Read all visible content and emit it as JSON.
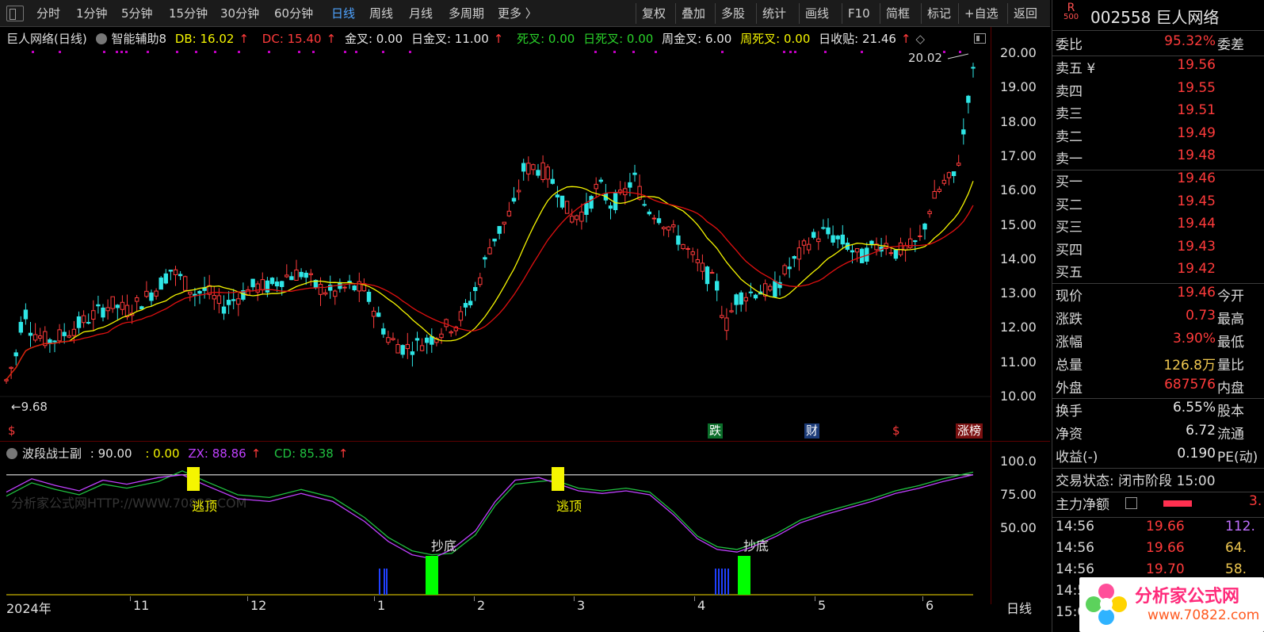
{
  "toolbar": {
    "left_items": [
      "分时",
      "1分钟",
      "5分钟",
      "15分钟",
      "30分钟",
      "60分钟",
      "日线",
      "周线",
      "月线",
      "多周期",
      "更多 〉"
    ],
    "active_index": 6,
    "right_items": [
      "复权",
      "叠加",
      "多股",
      "统计",
      "画线",
      "F10",
      "简框",
      "标记",
      "+自选",
      "返回"
    ]
  },
  "main": {
    "title": "巨人网络(日线)",
    "indicator_name": "智能辅助8",
    "db": "DB: 16.02",
    "dc": "DC: 15.40",
    "jincha": "金叉: 0.00",
    "ri_jincha": "日金叉: 11.00",
    "sicha": "死叉: 0.00",
    "ri_sicha": "日死叉: 0.00",
    "zhou_jincha": "周金叉: 6.00",
    "zhou_sicha": "周死叉: 0.00",
    "ri_shoutie": "日收贴: 21.46",
    "high_label": "20.02",
    "low_label": "9.68",
    "y_ticks": [
      "20.00",
      "19.00",
      "18.00",
      "17.00",
      "16.00",
      "15.00",
      "14.00",
      "13.00",
      "12.00",
      "11.00",
      "10.00"
    ],
    "tags": {
      "die": "跌",
      "cai": "财",
      "zhangbang": "涨榜"
    }
  },
  "indicator": {
    "name": "波段战士副",
    "v1": "90.00",
    "v2": ": 0.00",
    "zx": "ZX: 88.86",
    "cd": "CD: 85.38",
    "y_ticks": [
      "100.0",
      "75.00",
      "50.00"
    ],
    "label_top1": "逃顶",
    "label_top2": "逃顶",
    "label_bottom1": "抄底",
    "label_bottom2": "抄底",
    "watermark": "分析家公式网HTTP://WWW.70822.COM"
  },
  "xaxis": {
    "labels": [
      "2024年",
      "11",
      "12",
      "1",
      "2",
      "3",
      "4",
      "5",
      "6"
    ],
    "period": "日线"
  },
  "quote": {
    "badge": "R 500",
    "code": "002558",
    "name": "巨人网络",
    "weibi_label": "委比",
    "weibi_value": "95.32%",
    "weicha_label": "委差",
    "asks": [
      {
        "label": "卖五 ¥",
        "price": "19.56"
      },
      {
        "label": "卖四",
        "price": "19.55"
      },
      {
        "label": "卖三",
        "price": "19.51"
      },
      {
        "label": "卖二",
        "price": "19.49"
      },
      {
        "label": "卖一",
        "price": "19.48"
      }
    ],
    "bids": [
      {
        "label": "买一",
        "price": "19.46"
      },
      {
        "label": "买二",
        "price": "19.45"
      },
      {
        "label": "买三",
        "price": "19.44"
      },
      {
        "label": "买四",
        "price": "19.43"
      },
      {
        "label": "买五",
        "price": "19.42"
      }
    ],
    "stats": [
      {
        "label": "现价",
        "value": "19.46",
        "right": "今开",
        "color": "red"
      },
      {
        "label": "涨跌",
        "value": "0.73",
        "right": "最高",
        "color": "red"
      },
      {
        "label": "涨幅",
        "value": "3.90%",
        "right": "最低",
        "color": "red"
      },
      {
        "label": "总量",
        "value": "126.8万",
        "right": "量比",
        "color": "yellow"
      },
      {
        "label": "外盘",
        "value": "687576",
        "right": "内盘",
        "color": "red"
      }
    ],
    "stats2": [
      {
        "label": "换手",
        "value": "6.55%",
        "right": "股本",
        "color": "white"
      },
      {
        "label": "净资",
        "value": "6.72",
        "right": "流通",
        "color": "white"
      },
      {
        "label": "收益(-)",
        "value": "0.190",
        "right": "PE(动)",
        "color": "white"
      }
    ],
    "trade_status": "交易状态: 闭市阶段 15:00",
    "main_net_label": "主力净额",
    "main_net_value": "3.",
    "ticks": [
      {
        "time": "14:56",
        "price": "19.66",
        "vol": "112."
      },
      {
        "time": "14:56",
        "price": "19.66",
        "vol": "64."
      },
      {
        "time": "14:56",
        "price": "19.70",
        "vol": "58."
      },
      {
        "time": "14:5",
        "price": "",
        "vol": ""
      },
      {
        "time": "15:0",
        "price": "",
        "vol": ""
      }
    ]
  },
  "logo": {
    "text": "分析家公式网",
    "url": "www.70822.com"
  },
  "colors": {
    "up": "#ff3b3b",
    "down": "#2ee6e6",
    "ma_fast": "#f5f500",
    "ma_slow": "#e01010",
    "zx": "#c040ff",
    "cd": "#20c040"
  }
}
